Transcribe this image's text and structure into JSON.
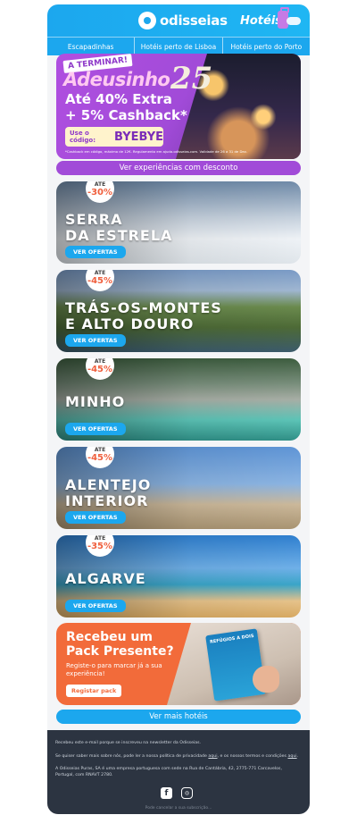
{
  "header": {
    "logo_text": "odisseias",
    "hoteis_label": "Hotéis"
  },
  "nav": {
    "items": [
      {
        "label": "Escapadinhas"
      },
      {
        "label": "Hotéis perto de Lisboa"
      },
      {
        "label": "Hotéis perto do Porto"
      }
    ]
  },
  "promo": {
    "tag": "A TERMINAR!",
    "title": "Adeusinho",
    "year": "25",
    "line1": "Até 40% Extra",
    "line2": "+ 5% Cashback*",
    "code_label": "Use o código:",
    "code_value": "BYEBYE",
    "fine_print": "*Cashback em código, máximo de 12€. Regulamento em ajuda.odisseias.com. Validade de 26 a 31 de Dez.",
    "button_label": "Ver experiências com desconto"
  },
  "destinations": [
    {
      "ate": "ATÉ",
      "discount": "-30%",
      "name_line1": "SERRA",
      "name_line2": "DA ESTRELA",
      "button": "VER OFERTAS",
      "bg_color": "#b9c7d6"
    },
    {
      "ate": "ATÉ",
      "discount": "-45%",
      "name_line1": "TRÁS-OS-MONTES",
      "name_line2": "E ALTO DOURO",
      "button": "VER OFERTAS",
      "bg_color": "#5f7d4a"
    },
    {
      "ate": "ATÉ",
      "discount": "-45%",
      "name_line1": "MINHO",
      "name_line2": "",
      "button": "VER OFERTAS",
      "bg_color": "#4f7b5e"
    },
    {
      "ate": "ATÉ",
      "discount": "-45%",
      "name_line1": "ALENTEJO",
      "name_line2": "INTERIOR",
      "button": "VER OFERTAS",
      "bg_color": "#6f9bd0"
    },
    {
      "ate": "ATÉ",
      "discount": "-35%",
      "name_line1": "ALGARVE",
      "name_line2": "",
      "button": "VER OFERTAS",
      "bg_color": "#3f8fd1"
    }
  ],
  "pack": {
    "title": "Recebeu um Pack Presente?",
    "text": "Registe-o para marcar já a sua experiência!",
    "button": "Registar pack",
    "book_title": "REFÚGIOS A DOIS"
  },
  "more_hotels_label": "Ver mais hotéis",
  "footer": {
    "line1": "Recebeu este e-mail porque se inscreveu na newsletter da Odisseias.",
    "line2_prefix": "Se quiser saber mais sobre nós, pode ler a nossa política de privacidade ",
    "line2_link1": "aqui",
    "line2_middle": ", e os nossos termos e condições ",
    "line2_link2": "aqui",
    "line2_suffix": ".",
    "line3": "A Odisseias Puras, SA é uma empresa portuguesa com sede na Rua de Cantábria, 42, 2775-771 Carcavelos, Portugal, com RNAVT 2780.",
    "facebook_glyph": "f",
    "instagram_glyph": "◎",
    "unsubscribe": "Pode cancelar a sua subscrição..."
  }
}
